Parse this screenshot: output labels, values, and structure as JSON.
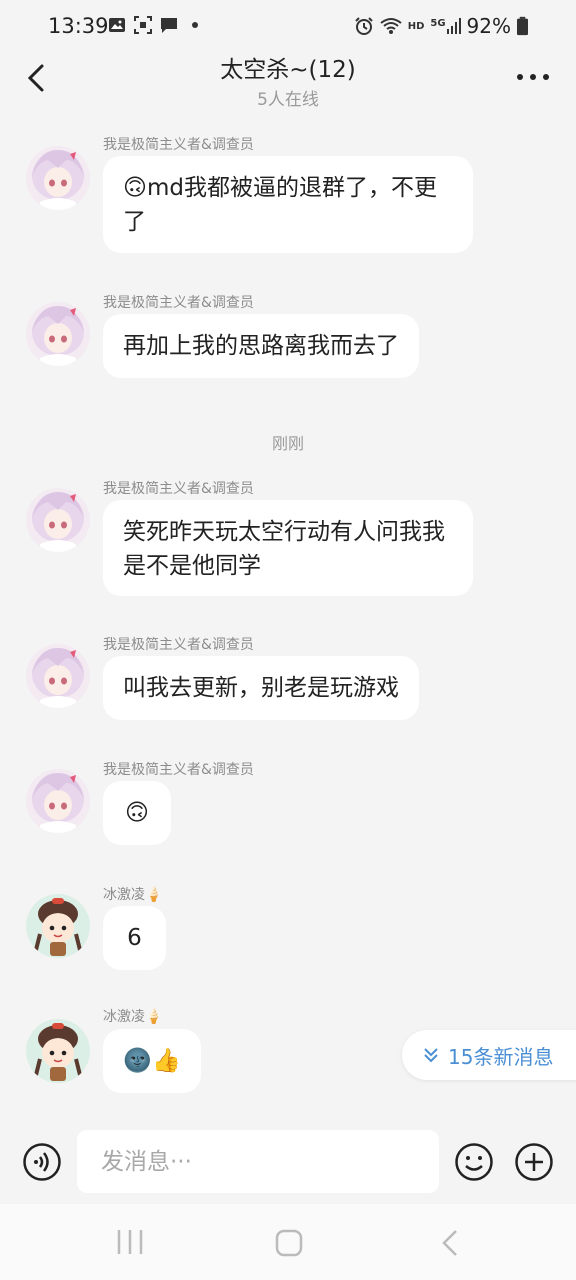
{
  "status_bar": {
    "time": "13:39",
    "battery": "92%",
    "left_icons": [
      "image-icon",
      "screenshot-icon",
      "message-icon",
      "dot-icon"
    ],
    "right_icons": [
      "alarm-icon",
      "wifi-icon",
      "hd-icon",
      "signal-5g-icon",
      "battery-icon"
    ],
    "hd_label": "HD",
    "signal_label": "5G"
  },
  "header": {
    "title": "太空杀~(12)",
    "subtitle": "5人在线"
  },
  "messages": [
    {
      "sender": "我是极简主义者&调查员",
      "text": "🙃md我都被逼的退群了，不更了",
      "avatar": "anime-girl-avatar"
    },
    {
      "sender": "我是极简主义者&调查员",
      "text": "再加上我的思路离我而去了",
      "avatar": "anime-girl-avatar"
    },
    {
      "sender": "我是极简主义者&调查员",
      "text": "笑死昨天玩太空行动有人问我我是不是他同学",
      "avatar": "anime-girl-avatar"
    },
    {
      "sender": "我是极简主义者&调查员",
      "text": "叫我去更新，别老是玩游戏",
      "avatar": "anime-girl-avatar"
    },
    {
      "sender": "我是极简主义者&调查员",
      "text": "🙃",
      "avatar": "anime-girl-avatar"
    },
    {
      "sender": "冰激凌🍦",
      "text": "6",
      "avatar": "cartoon-girl-avatar"
    },
    {
      "sender": "冰激凌🍦",
      "text": "🌚👍",
      "avatar": "cartoon-girl-avatar"
    }
  ],
  "time_divider": "刚刚",
  "new_messages": "15条新消息",
  "input": {
    "placeholder": "发消息···"
  },
  "colors": {
    "background": "#f4f4f4",
    "bubble": "#ffffff",
    "accent": "#4a8fd4"
  }
}
